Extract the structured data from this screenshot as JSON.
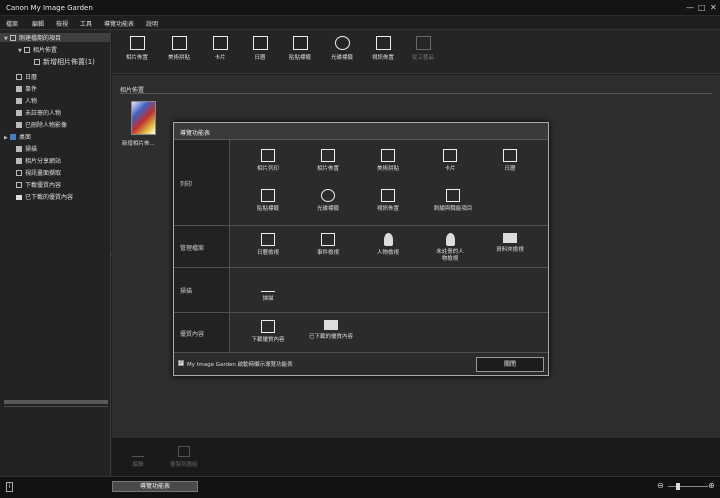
{
  "window": {
    "title": "Canon My Image Garden",
    "minimize": "—",
    "maximize": "□",
    "close": "✕"
  },
  "menu": [
    "檔案",
    "編輯",
    "檢視",
    "工具",
    "導覽功能表",
    "說明"
  ],
  "sidebar": {
    "items": [
      {
        "label": "剛建檔期的項目",
        "icon": "checklist-icon"
      },
      {
        "label": "相片佈置",
        "icon": "layout-icon"
      },
      {
        "label": "新增相片佈置(1)",
        "icon": "document-icon"
      },
      {
        "label": "日曆",
        "icon": "calendar-icon"
      },
      {
        "label": "事件",
        "icon": "event-icon"
      },
      {
        "label": "人物",
        "icon": "person-icon"
      },
      {
        "label": "未註冊的人物",
        "icon": "unregistered-person-icon"
      },
      {
        "label": "已刪除人物影像",
        "icon": "deleted-person-icon"
      },
      {
        "label": "桌面",
        "icon": "desktop-icon"
      },
      {
        "label": "掃描",
        "icon": "scan-icon"
      },
      {
        "label": "相片分享網站",
        "icon": "share-icon"
      },
      {
        "label": "視訊畫面擷取",
        "icon": "video-capture-icon"
      },
      {
        "label": "下載優質內容",
        "icon": "download-icon"
      },
      {
        "label": "已下載的優質內容",
        "icon": "folder-icon"
      }
    ]
  },
  "toolbar": [
    {
      "label": "相片佈置",
      "icon": "layout-icon",
      "enabled": true
    },
    {
      "label": "美術拼貼",
      "icon": "collage-icon",
      "enabled": true
    },
    {
      "label": "卡片",
      "icon": "card-icon",
      "enabled": true
    },
    {
      "label": "日曆",
      "icon": "calendar-icon",
      "enabled": true
    },
    {
      "label": "貼貼標籤",
      "icon": "sticker-icon",
      "enabled": true
    },
    {
      "label": "光碟標籤",
      "icon": "disc-icon",
      "enabled": true
    },
    {
      "label": "視訊佈置",
      "icon": "video-layout-icon",
      "enabled": true
    },
    {
      "label": "從工藝品",
      "icon": "craft-icon",
      "enabled": false
    }
  ],
  "content": {
    "header": "相片佈置",
    "thumbnail_label": "新增相片佈..."
  },
  "bottom_tools": [
    {
      "label": "編輯",
      "icon": "edit-icon"
    },
    {
      "label": "複製到圖組",
      "icon": "copy-icon"
    }
  ],
  "status": {
    "nav_button": "導覽功能表",
    "info": "i",
    "zoom_out": "⊖",
    "zoom_in": "⊕"
  },
  "dialog": {
    "title": "導覽功能表",
    "sections": [
      {
        "name": "列印",
        "items": [
          {
            "label": "相片列印",
            "icon": "photo-print-icon"
          },
          {
            "label": "相片佈置",
            "icon": "layout-icon"
          },
          {
            "label": "美術拼貼",
            "icon": "collage-icon"
          },
          {
            "label": "卡片",
            "icon": "card-icon"
          },
          {
            "label": "日曆",
            "icon": "calendar-icon"
          },
          {
            "label": "貼貼標籤",
            "icon": "sticker-icon"
          },
          {
            "label": "光碟標籤",
            "icon": "disc-icon"
          },
          {
            "label": "視訊佈置",
            "icon": "video-layout-icon"
          },
          {
            "label": "刺繡與職能項目",
            "icon": "craft-icon"
          }
        ]
      },
      {
        "name": "管理檔案",
        "items": [
          {
            "label": "日曆檢視",
            "icon": "calendar-icon"
          },
          {
            "label": "事件檢視",
            "icon": "event-icon"
          },
          {
            "label": "人物檢視",
            "icon": "person-icon"
          },
          {
            "label": "未註冊的人物檢視",
            "icon": "unregistered-person-icon"
          },
          {
            "label": "資料夾檢視",
            "icon": "folder-icon"
          }
        ]
      },
      {
        "name": "掃描",
        "items": [
          {
            "label": "掃描",
            "icon": "scan-icon"
          }
        ]
      },
      {
        "name": "優質內容",
        "items": [
          {
            "label": "下載優質內容",
            "icon": "download-icon"
          },
          {
            "label": "已下載的優質內容",
            "icon": "folder-icon"
          }
        ]
      }
    ],
    "startup_checkbox": "My Image Garden 啟動時顯示導覽功能表",
    "close_button": "關閉"
  }
}
